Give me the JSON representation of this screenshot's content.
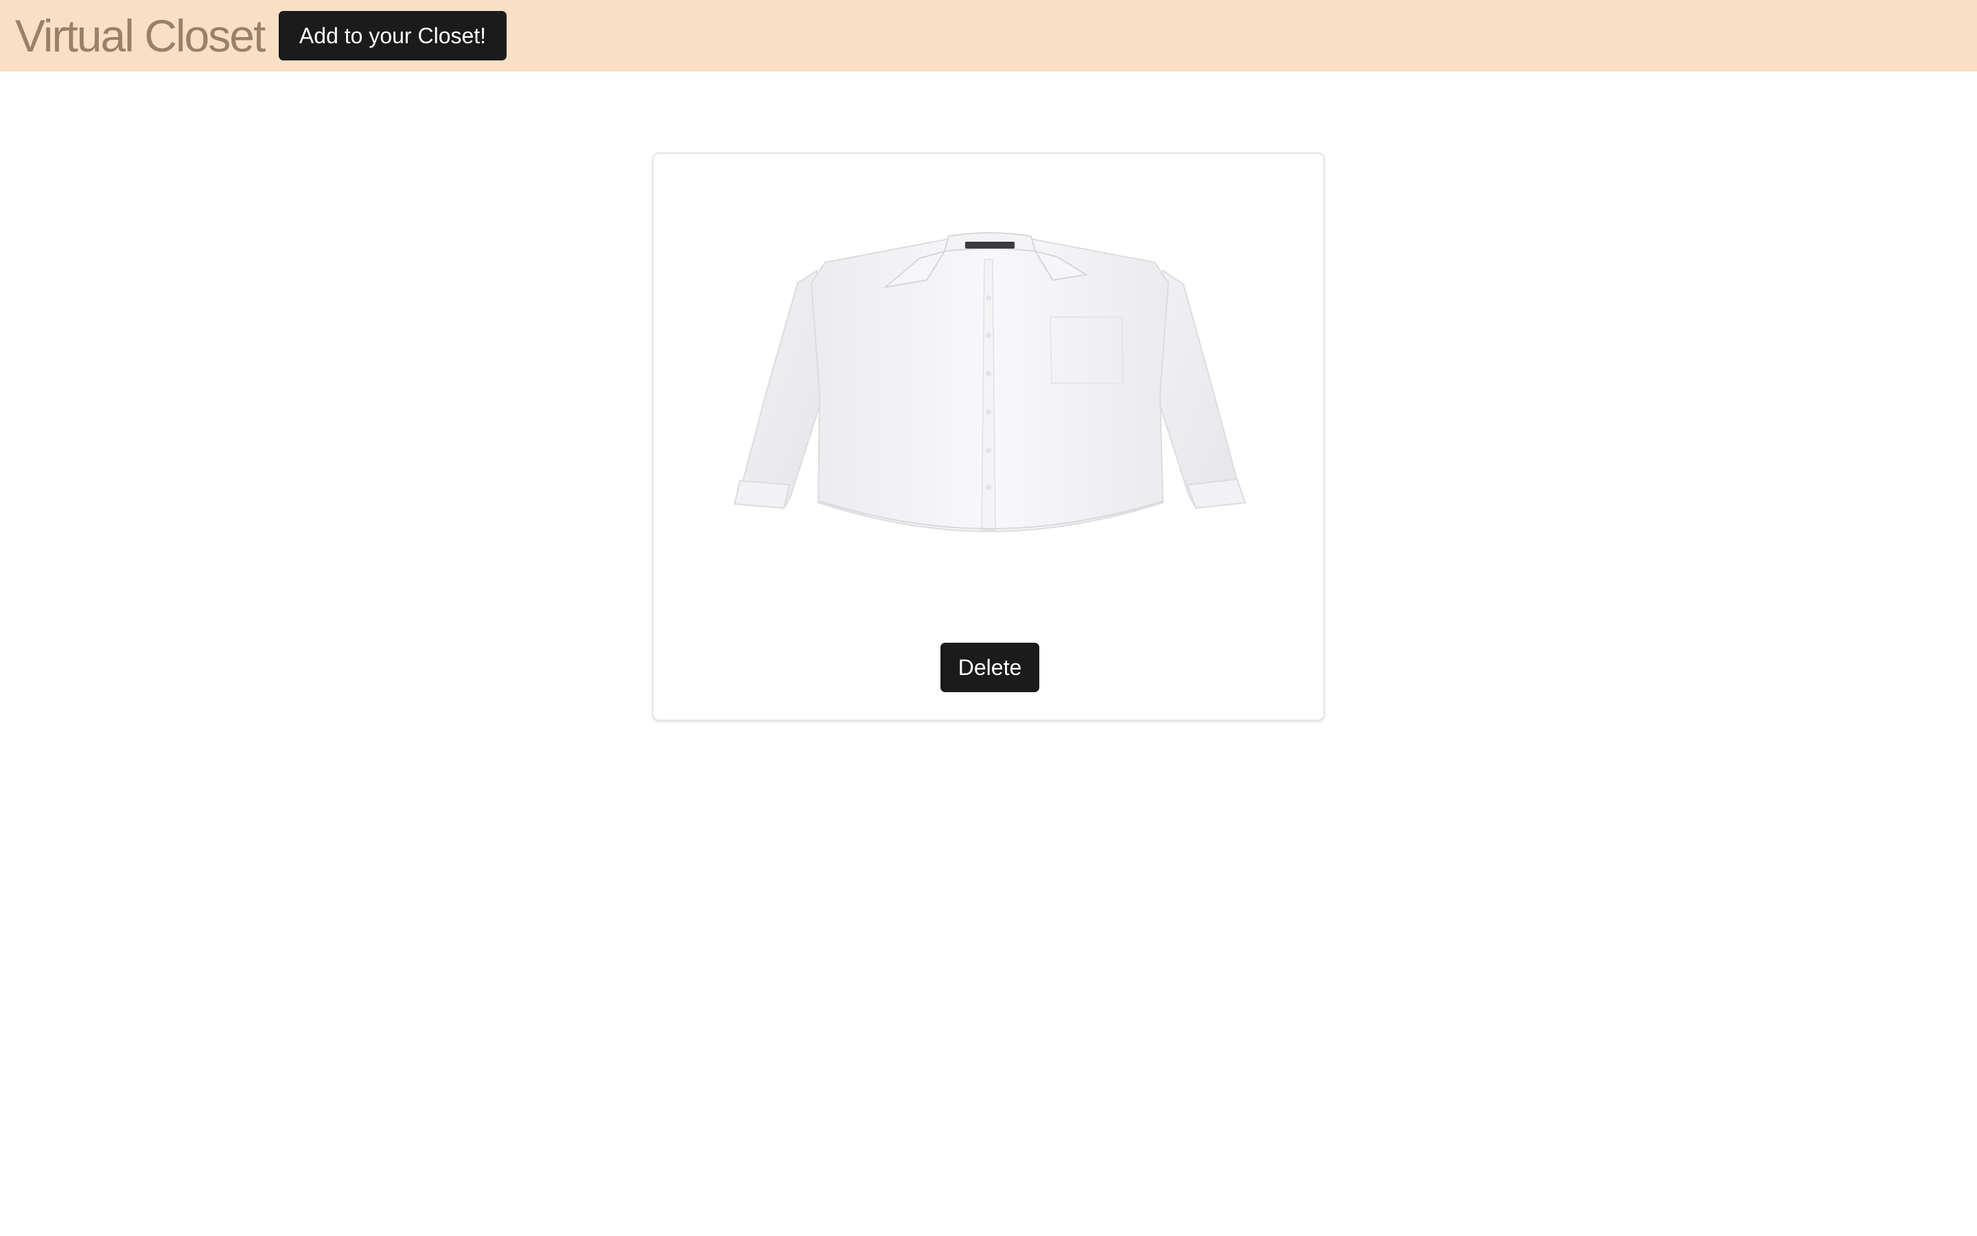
{
  "navbar": {
    "brand": "Virtual Closet",
    "add_button_label": "Add to your Closet!",
    "background_color": "#f9dfc6",
    "brand_color": "#9a8068"
  },
  "closet": {
    "items": [
      {
        "image": "white-button-up-shirt",
        "delete_label": "Delete"
      }
    ]
  },
  "colors": {
    "button_background": "#1b1b1b",
    "button_text": "#ffffff"
  }
}
